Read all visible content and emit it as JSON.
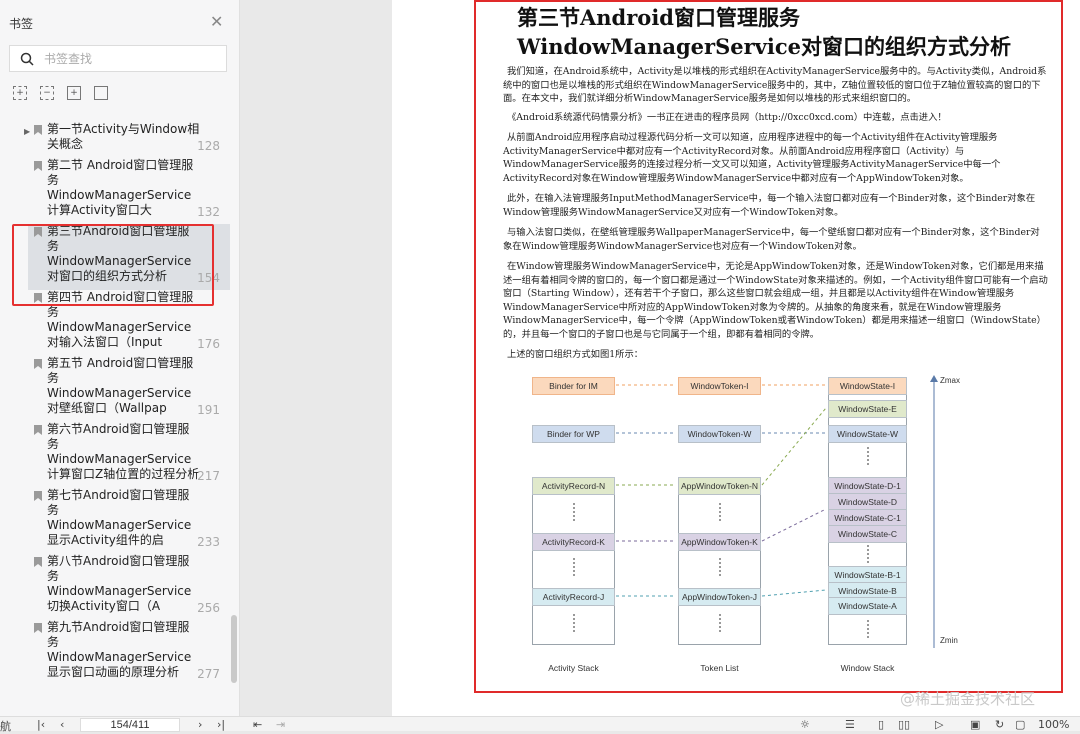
{
  "sidebar": {
    "title": "书签",
    "search_placeholder": "书签查找",
    "items": [
      {
        "label": "第一节Activity与Window相关概念",
        "page": "128"
      },
      {
        "label": "第二节 Android窗口管理服务WindowManagerService计算Activity窗口大",
        "page": "132"
      },
      {
        "label": "第三节Android窗口管理服务WindowManagerService对窗口的组织方式分析",
        "page": "154"
      },
      {
        "label": "第四节 Android窗口管理服务WindowManagerService对输入法窗口（Input",
        "page": "176"
      },
      {
        "label": "第五节 Android窗口管理服务WindowManagerService对壁纸窗口（Wallpap",
        "page": "191"
      },
      {
        "label": "第六节Android窗口管理服务WindowManagerService计算窗口Z轴位置的过程分析",
        "page": "217"
      },
      {
        "label": "第七节Android窗口管理服务WindowManagerService显示Activity组件的启",
        "page": "233"
      },
      {
        "label": "第八节Android窗口管理服务WindowManagerService切换Activity窗口（A",
        "page": "256"
      },
      {
        "label": "第九节Android窗口管理服务WindowManagerService显示窗口动画的原理分析",
        "page": "277"
      }
    ]
  },
  "document": {
    "title": "第三节Android窗口管理服务WindowManagerService对窗口的组织方式分析",
    "paragraphs": [
      "我们知道，在Android系统中，Activity是以堆栈的形式组织在ActivityManagerService服务中的。与Activity类似，Android系统中的窗口也是以堆栈的形式组织在WindowManagerService服务中的，其中，Z轴位置较低的窗口位于Z轴位置较高的窗口的下面。在本文中，我们就详细分析WindowManagerService服务是如何以堆栈的形式来组织窗口的。",
      "《Android系统源代码情景分析》一书正在进击的程序员网（http://0xcc0xcd.com）中连载，点击进入！",
      "从前面Android应用程序启动过程源代码分析一文可以知道，应用程序进程中的每一个Activity组件在Activity管理服务ActivityManagerService中都对应有一个ActivityRecord对象。从前面Android应用程序窗口（Activity）与WindowManagerService服务的连接过程分析一文又可以知道，Activity管理服务ActivityManagerService中每一个ActivityRecord对象在Window管理服务WindowManagerService中都对应有一个AppWindowToken对象。",
      "此外，在输入法管理服务InputMethodManagerService中，每一个输入法窗口都对应有一个Binder对象，这个Binder对象在Window管理服务WindowManagerService又对应有一个WindowToken对象。",
      "与输入法窗口类似，在壁纸管理服务WallpaperManagerService中，每一个壁纸窗口都对应有一个Binder对象，这个Binder对象在Window管理服务WindowManagerService也对应有一个WindowToken对象。",
      "在Window管理服务WindowManagerService中，无论是AppWindowToken对象，还是WindowToken对象，它们都是用来描述一组有着相同令牌的窗口的，每一个窗口都是通过一个WindowState对象来描述的。例如，一个Activity组件窗口可能有一个启动窗口（Starting Window），还有若干个子窗口，那么这些窗口就会组成一组，并且都是以Activity组件在Window管理服务WindowManagerService中所对应的AppWindowToken对象为令牌的。从抽象的角度来看，就是在Window管理服务WindowManagerService中，每一个令牌（AppWindowToken或者WindowToken）都是用来描述一组窗口（WindowState）的，并且每一个窗口的子窗口也是与它同属于一个组，即都有着相同的令牌。",
      "上述的窗口组织方式如图1所示："
    ]
  },
  "diagram": {
    "binder_im": "Binder for IM",
    "binder_wp": "Binder for WP",
    "token_i": "WindowToken-I",
    "token_w": "WindowToken-W",
    "ar_n": "ActivityRecord-N",
    "ar_k": "ActivityRecord-K",
    "ar_j": "ActivityRecord-J",
    "awt_n": "AppWindowToken-N",
    "awt_k": "AppWindowToken-K",
    "awt_j": "AppWindowToken-J",
    "ws": [
      "WindowState-I",
      "WindowState-E",
      "WindowState-W",
      "WindowState-D-1",
      "WindowState-D",
      "WindowState-C-1",
      "WindowState-C",
      "WindowState-B-1",
      "WindowState-B",
      "WindowState-A"
    ],
    "zmax": "Zmax",
    "zmin": "Zmin",
    "label_activity": "Activity Stack",
    "label_token": "Token List",
    "label_window": "Window Stack"
  },
  "watermark": "@稀土掘金技术社区",
  "toolbar": {
    "nav_label": "航",
    "page_value": "154/411",
    "zoom": "100%"
  },
  "colors": {
    "orange": "#fbd9bd",
    "blue": "#cfdcee",
    "green": "#e0e9cb",
    "purple": "#d9d2e4",
    "cyan": "#d6ebf1",
    "highlight": "#e02a2a"
  }
}
